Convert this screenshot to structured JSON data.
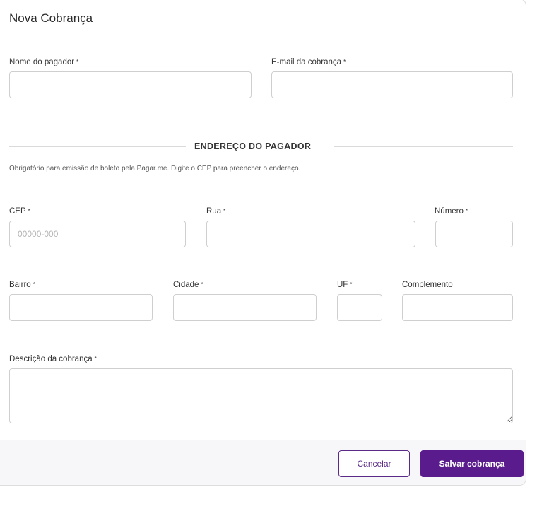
{
  "modal": {
    "title": "Nova Cobrança"
  },
  "fields": {
    "payer_name": {
      "label": "Nome do pagador",
      "value": ""
    },
    "billing_email": {
      "label": "E-mail da cobrança",
      "value": ""
    },
    "cep": {
      "label": "CEP",
      "placeholder": "00000-000",
      "value": ""
    },
    "street": {
      "label": "Rua",
      "value": ""
    },
    "number": {
      "label": "Número",
      "value": ""
    },
    "district": {
      "label": "Bairro",
      "value": ""
    },
    "city": {
      "label": "Cidade",
      "value": ""
    },
    "state": {
      "label": "UF",
      "value": ""
    },
    "complement": {
      "label": "Complemento",
      "value": ""
    },
    "description": {
      "label": "Descrição da cobrança",
      "value": ""
    }
  },
  "address_section": {
    "title": "ENDEREÇO DO PAGADOR",
    "hint": "Obrigatório para emissão de boleto pela Pagar.me. Digite o CEP para preencher o endereço."
  },
  "required_marker": "*",
  "footer": {
    "cancel_label": "Cancelar",
    "save_label": "Salvar cobrança"
  },
  "colors": {
    "primary": "#5a1c8c",
    "border": "#cfcfcf",
    "footer_bg": "#f7f7f9"
  }
}
